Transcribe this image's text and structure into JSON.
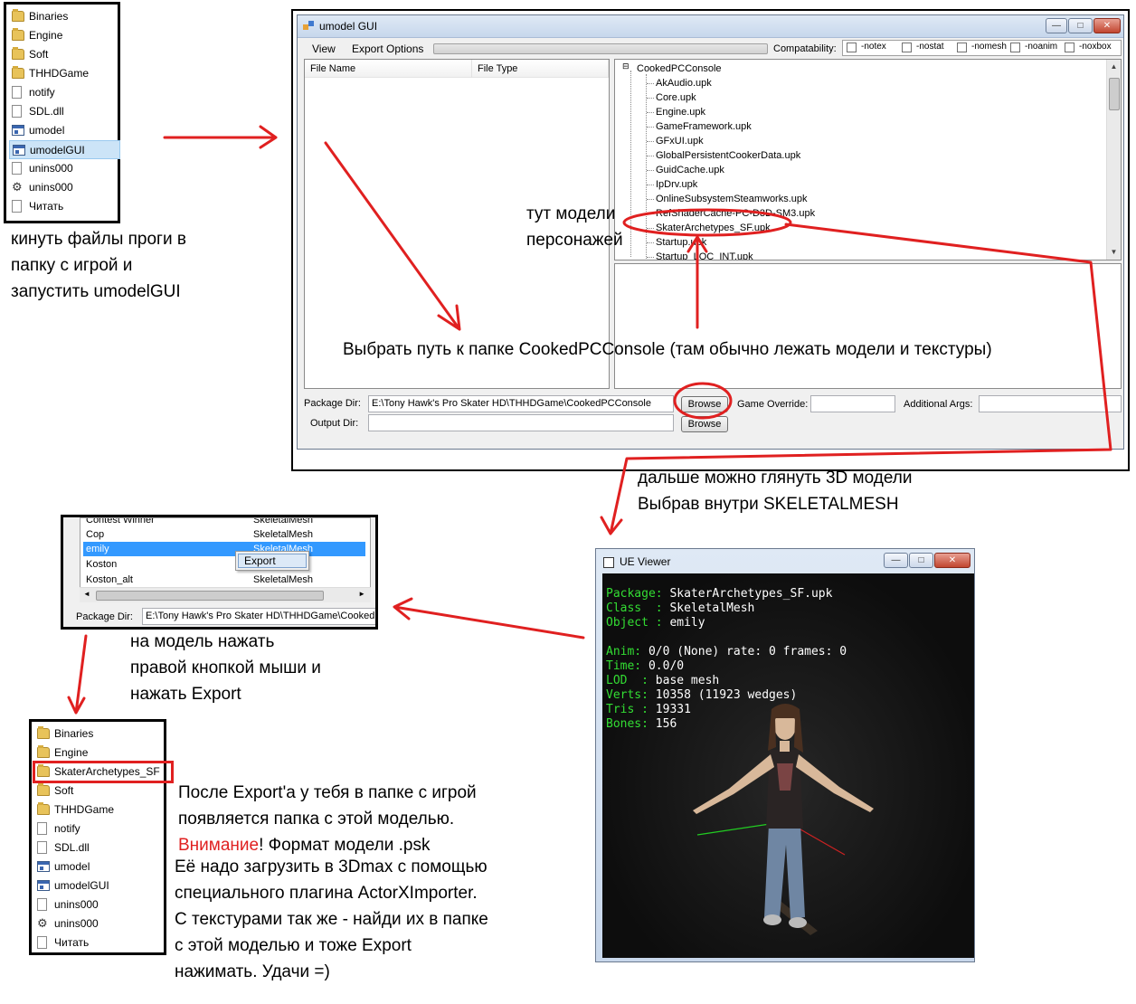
{
  "explorer_top": {
    "items": [
      {
        "label": "Binaries",
        "icon": "folder"
      },
      {
        "label": "Engine",
        "icon": "folder"
      },
      {
        "label": "Soft",
        "icon": "folder"
      },
      {
        "label": "THHDGame",
        "icon": "folder"
      },
      {
        "label": "notify",
        "icon": "file"
      },
      {
        "label": "SDL.dll",
        "icon": "file"
      },
      {
        "label": "umodel",
        "icon": "app"
      },
      {
        "label": "umodelGUI",
        "icon": "app",
        "selected": true
      },
      {
        "label": "unins000",
        "icon": "file"
      },
      {
        "label": "unins000",
        "icon": "setup"
      },
      {
        "label": "Читать",
        "icon": "file"
      }
    ]
  },
  "notes": {
    "step1": [
      "кинуть файлы проги в",
      "папку с игрой и",
      "запустить umodelGUI"
    ],
    "models_here": [
      "тут модели",
      "персонажей"
    ],
    "choose_path": "Выбрать путь к папке CookedPCConsole (там обычно лежать модели и текстуры)",
    "view3d": [
      "дальше можно глянуть 3D модели",
      "Выбрав внутри SKELETALMESH"
    ],
    "rightclick": [
      "на модель нажать",
      "правой кнопкой мыши и",
      "нажать Export"
    ],
    "after_export_1": "После Export'а  у тебя в папке с игрой",
    "after_export_2": "появляется папка с этой моделью.",
    "warning_word": "Внимание",
    "warning_rest": "! Формат модели .psk",
    "after_export_3": [
      "Её надо загрузить в 3Dmax с помощью",
      "специального плагина ActorXImporter.",
      "С текстурами так же - найди их в папке",
      "с этой моделью и тоже Export",
      "нажимать. Удачи =)"
    ]
  },
  "umodel_gui": {
    "title": "umodel GUI",
    "window_buttons": {
      "minimize": "—",
      "maximize": "□",
      "close": "✕"
    },
    "menu": {
      "view": "View",
      "export_options": "Export Options"
    },
    "compat_label": "Compatability:",
    "compat_options": [
      "-notex",
      "-nostat",
      "-nomesh",
      "-noanim",
      "-noxbox"
    ],
    "columns": {
      "file_name": "File Name",
      "file_type": "File Type"
    },
    "tree_root": "CookedPCConsole",
    "tree_items": [
      "AkAudio.upk",
      "Core.upk",
      "Engine.upk",
      "GameFramework.upk",
      "GFxUI.upk",
      "GlobalPersistentCookerData.upk",
      "GuidCache.upk",
      "IpDrv.upk",
      "OnlineSubsystemSteamworks.upk",
      "RefShaderCache-PC-D3D-SM3.upk",
      "SkaterArchetypes_SF.upk",
      "Startup.upk",
      "Startup_LOC_INT.upk"
    ],
    "package_dir_label": "Package Dir:",
    "package_dir_value": "E:\\Tony Hawk's Pro Skater HD\\THHDGame\\CookedPCConsole",
    "browse1": "Browse",
    "game_override_label": "Game Override:",
    "additional_args_label": "Additional Args:",
    "output_dir_label": "Output Dir:",
    "browse2": "Browse"
  },
  "export_window": {
    "rows": [
      {
        "name": "Contest Winner",
        "type": "SkeletalMesh"
      },
      {
        "name": "Cop",
        "type": "SkeletalMesh"
      },
      {
        "name": "emily",
        "type": "SkeletalMesh",
        "selected": true
      },
      {
        "name": "Koston",
        "type": ""
      },
      {
        "name": "Koston_alt",
        "type": "SkeletalMesh"
      }
    ],
    "context_menu_item": "Export",
    "package_dir_label": "Package Dir:",
    "package_dir_value": "E:\\Tony Hawk's Pro Skater HD\\THHDGame\\Cooked"
  },
  "ue_viewer": {
    "title": "UE Viewer",
    "lines": [
      {
        "key": "Package:",
        "value": " SkaterArchetypes_SF.upk"
      },
      {
        "key": "Class  :",
        "value": " SkeletalMesh"
      },
      {
        "key": "Object :",
        "value": " emily"
      },
      {
        "key": "",
        "value": ""
      },
      {
        "key": "Anim:",
        "value": " 0/0 (None) rate: 0 frames: 0"
      },
      {
        "key": "Time:",
        "value": " 0.0/0"
      },
      {
        "key": "LOD  :",
        "value": " base mesh"
      },
      {
        "key": "Verts:",
        "value": " 10358 (11923 wedges)"
      },
      {
        "key": "Tris :",
        "value": " 19331"
      },
      {
        "key": "Bones:",
        "value": " 156"
      }
    ]
  },
  "explorer_bottom": {
    "items": [
      {
        "label": "Binaries",
        "icon": "folder"
      },
      {
        "label": "Engine",
        "icon": "folder"
      },
      {
        "label": "SkaterArchetypes_SF",
        "icon": "folder",
        "boxed": true
      },
      {
        "label": "Soft",
        "icon": "folder"
      },
      {
        "label": "THHDGame",
        "icon": "folder"
      },
      {
        "label": "notify",
        "icon": "file"
      },
      {
        "label": "SDL.dll",
        "icon": "file"
      },
      {
        "label": "umodel",
        "icon": "app"
      },
      {
        "label": "umodelGUI",
        "icon": "app"
      },
      {
        "label": "unins000",
        "icon": "file"
      },
      {
        "label": "unins000",
        "icon": "setup"
      },
      {
        "label": "Читать",
        "icon": "file"
      }
    ]
  },
  "colors": {
    "annotation": "#e02020",
    "console_key": "#33dd33",
    "selection": "#3399ff"
  }
}
